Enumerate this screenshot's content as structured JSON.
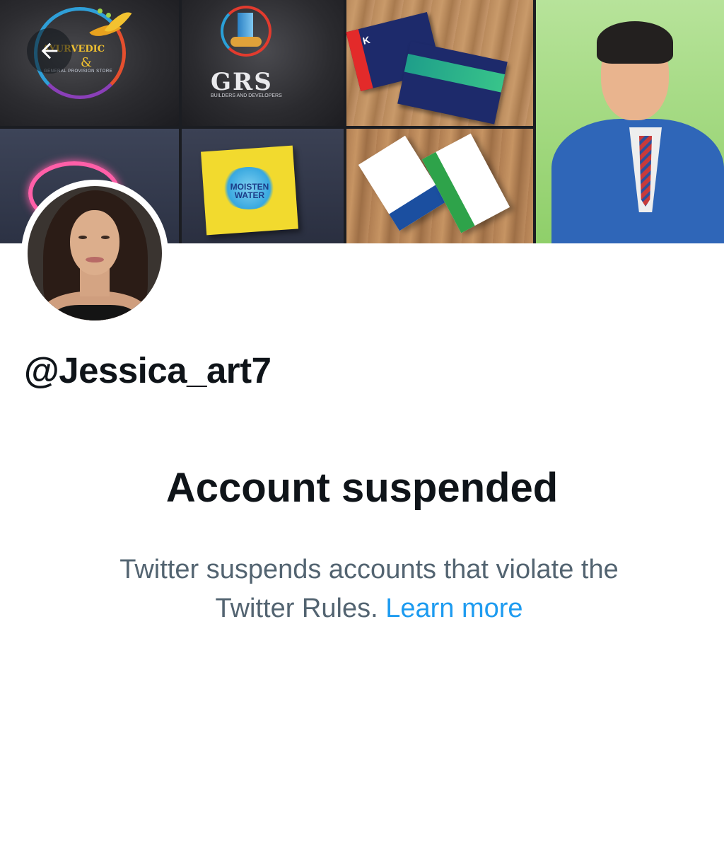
{
  "header": {
    "back_icon": "arrow-left-icon",
    "banner": {
      "tiles": [
        {
          "name": "ayurvedic-logo",
          "text": "AYURVEDIC",
          "amp": "&",
          "sub": "GENERAL PROVISION STORE"
        },
        {
          "name": "grs-logo",
          "text": "GRS",
          "sub": "BUILDERS AND DEVELOPERS"
        },
        {
          "name": "neon-sign"
        },
        {
          "name": "moisten-water-sign",
          "line1": "MOISTEN",
          "line2": "WATER"
        },
        {
          "name": "business-cards",
          "text": "K"
        },
        {
          "name": "business-cards-green"
        },
        {
          "name": "cartoon-portrait"
        }
      ]
    }
  },
  "profile": {
    "handle": "@Jessica_art7"
  },
  "suspension": {
    "title": "Account suspended",
    "description": "Twitter suspends accounts that violate the Twitter Rules.",
    "link_label": "Learn more",
    "link_color": "#1d9bf0"
  },
  "colors": {
    "text_primary": "#0f1419",
    "text_secondary": "#536471",
    "accent": "#1d9bf0"
  }
}
